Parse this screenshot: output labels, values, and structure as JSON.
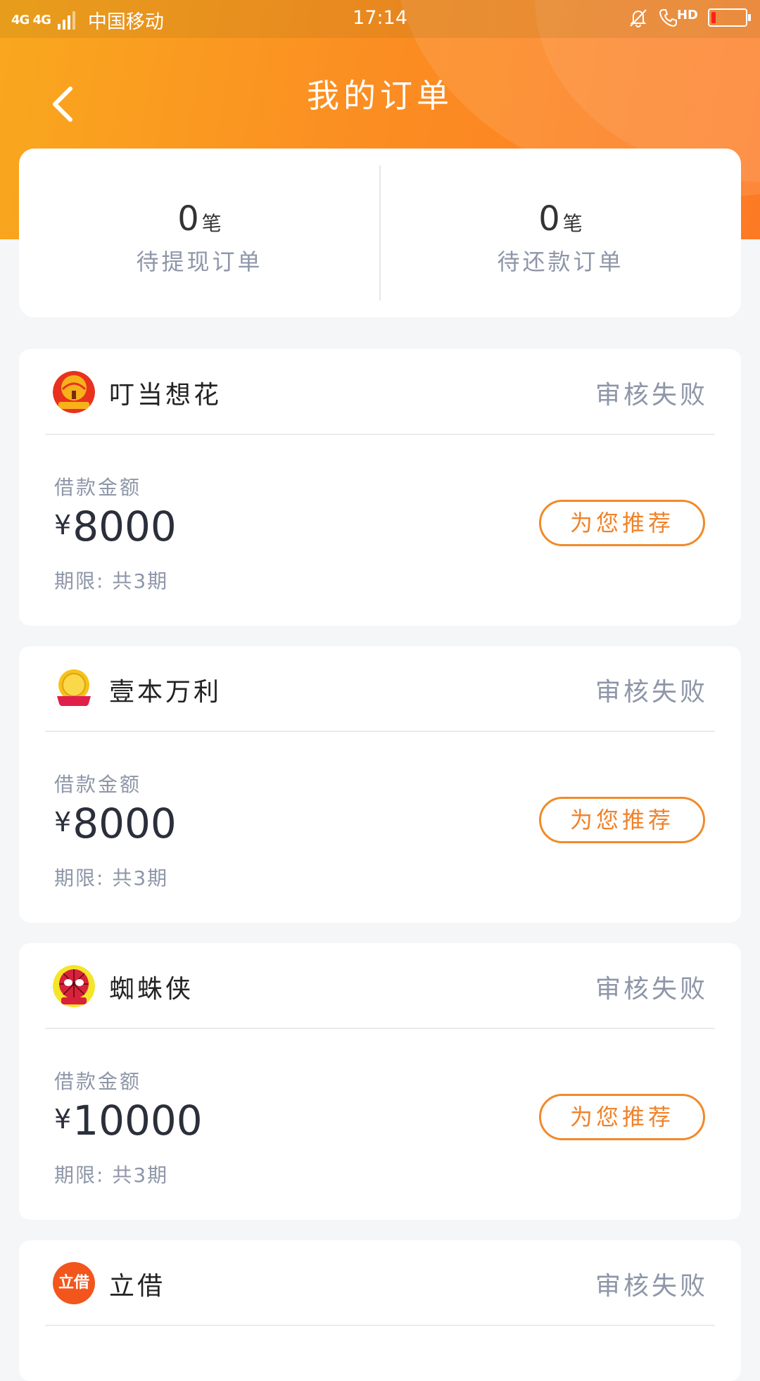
{
  "status_bar": {
    "network": "4G 4G",
    "carrier": "中国移动",
    "time": "17:14",
    "hd_label": "HD"
  },
  "header": {
    "title": "我的订单"
  },
  "summary": {
    "withdraw": {
      "count": "0",
      "unit": "笔",
      "label": "待提现订单"
    },
    "repay": {
      "count": "0",
      "unit": "笔",
      "label": "待还款订单"
    }
  },
  "orders": [
    {
      "name": "叮当想花",
      "status": "审核失败",
      "amount_label": "借款金额",
      "currency": "¥",
      "amount": "8000",
      "term": "期限: 共3期",
      "button": "为您推荐",
      "logo_icon": "dingdang-logo-icon"
    },
    {
      "name": "壹本万利",
      "status": "审核失败",
      "amount_label": "借款金额",
      "currency": "¥",
      "amount": "8000",
      "term": "期限: 共3期",
      "button": "为您推荐",
      "logo_icon": "yiben-logo-icon"
    },
    {
      "name": "蜘蛛侠",
      "status": "审核失败",
      "amount_label": "借款金额",
      "currency": "¥",
      "amount": "10000",
      "term": "期限: 共3期",
      "button": "为您推荐",
      "logo_icon": "spiderman-logo-icon"
    },
    {
      "name": "立借",
      "status": "审核失败",
      "logo_icon": "lijie-logo-icon",
      "logo_text": "立借"
    }
  ],
  "colors": {
    "accent": "#f0822a",
    "header_start": "#f9a81e",
    "header_end": "#fd7a24",
    "muted_text": "#8e96a8",
    "background": "#f4f6f8"
  }
}
